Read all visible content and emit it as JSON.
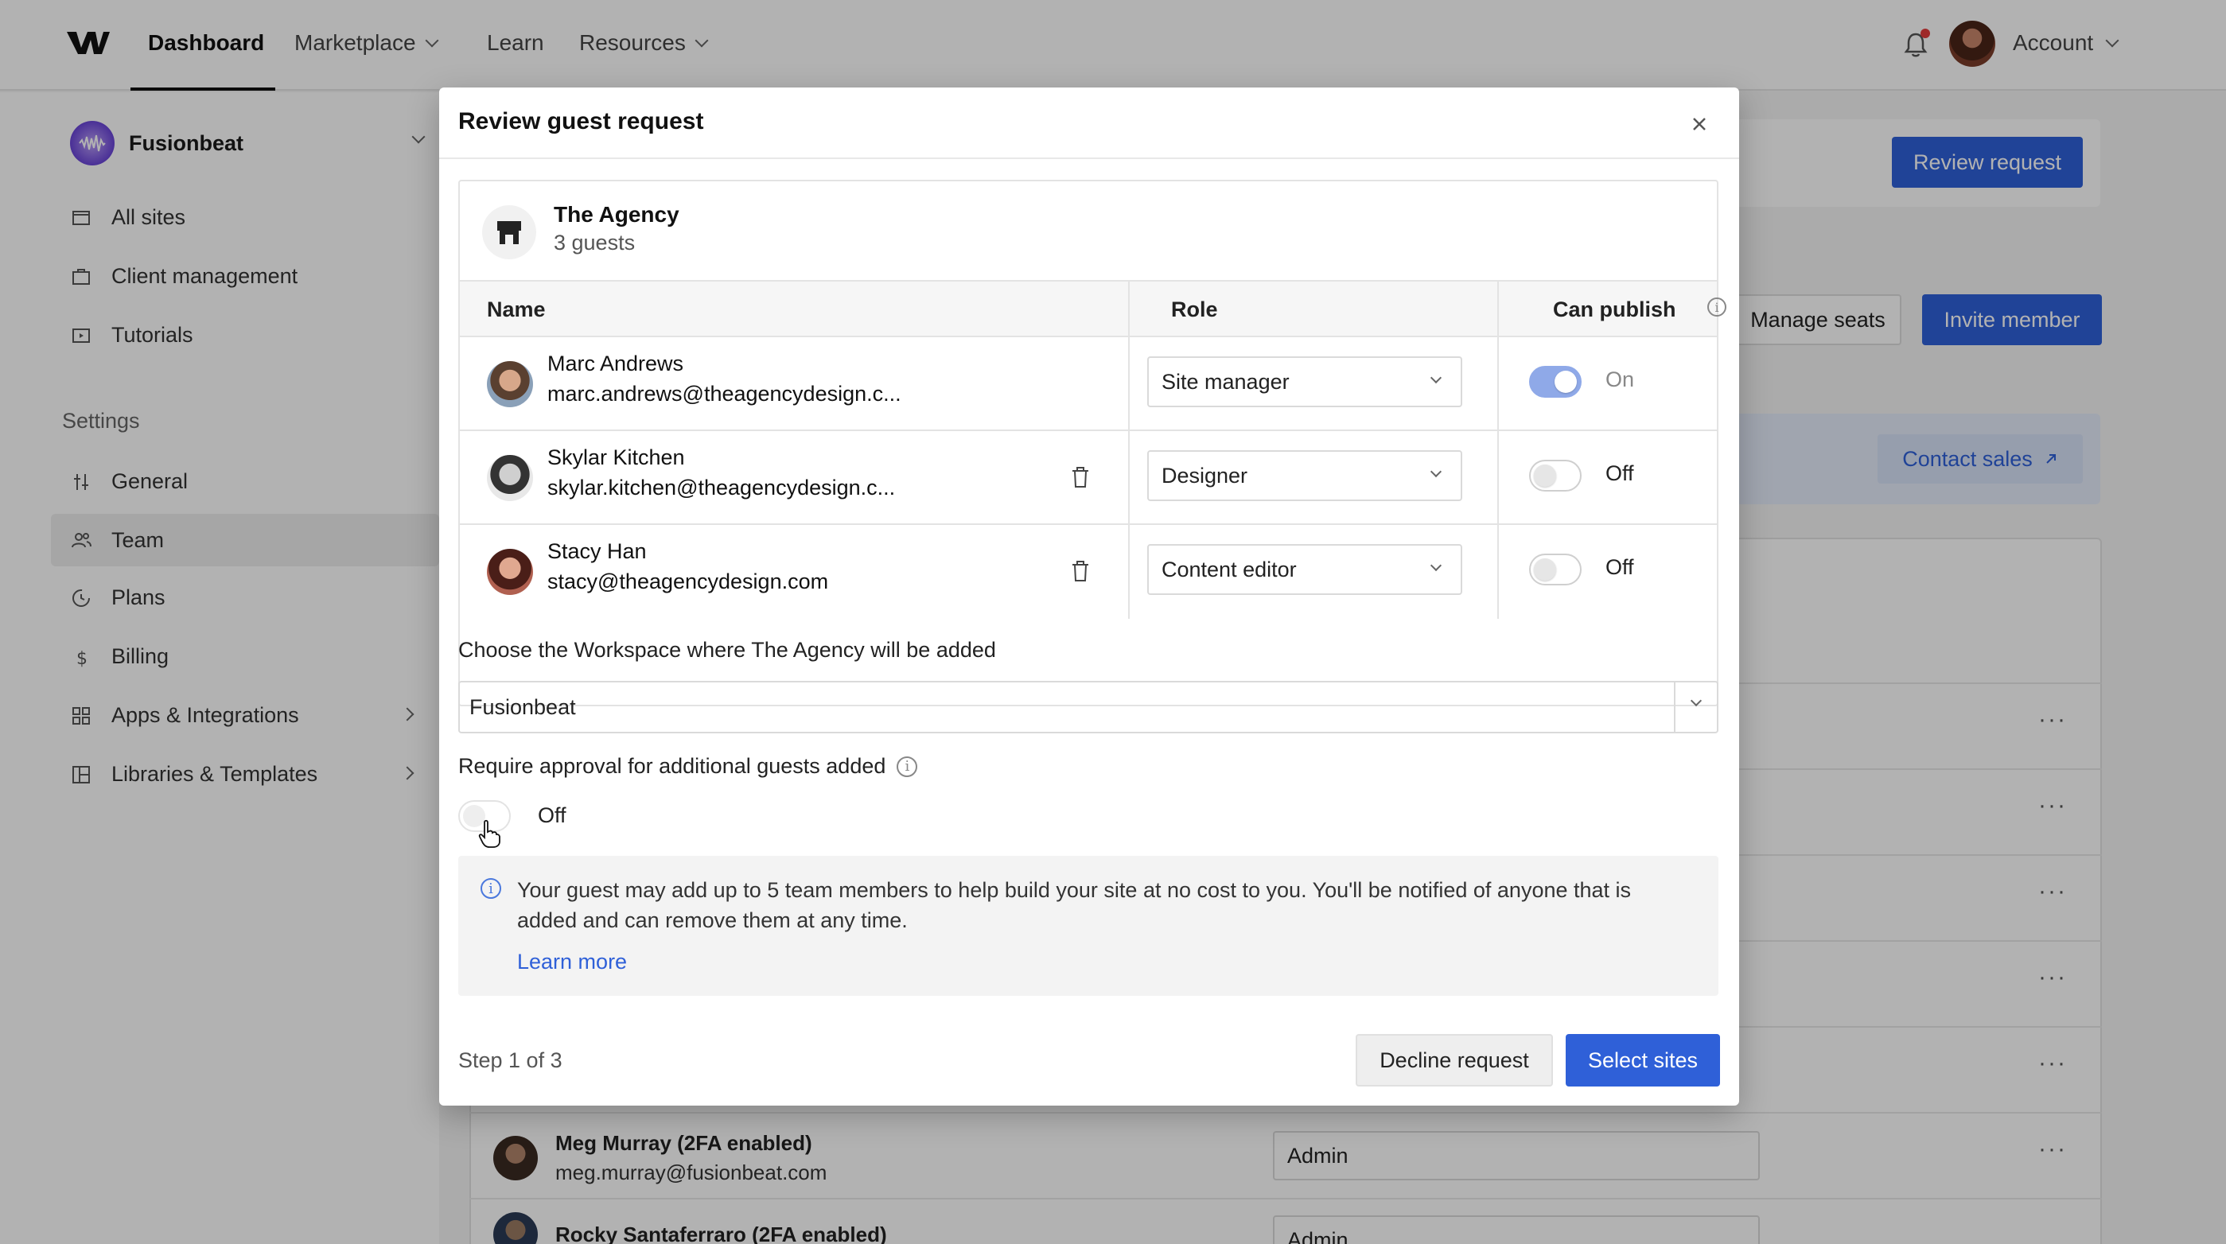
{
  "topnav": {
    "items": [
      {
        "label": "Dashboard"
      },
      {
        "label": "Marketplace"
      },
      {
        "label": "Learn"
      },
      {
        "label": "Resources"
      }
    ],
    "account_label": "Account"
  },
  "sidebar": {
    "workspace": "Fusionbeat",
    "items": [
      {
        "label": "All sites"
      },
      {
        "label": "Client management"
      },
      {
        "label": "Tutorials"
      }
    ],
    "settings_heading": "Settings",
    "settings_items": [
      {
        "label": "General"
      },
      {
        "label": "Team"
      },
      {
        "label": "Plans"
      },
      {
        "label": "Billing"
      },
      {
        "label": "Apps & Integrations"
      },
      {
        "label": "Libraries & Templates"
      }
    ]
  },
  "background": {
    "review_request": "Review request",
    "manage_seats": "Manage seats",
    "invite_member": "Invite member",
    "contact_sales": "Contact sales",
    "members": [
      {
        "name": "Meg Murray (2FA enabled)",
        "email": "meg.murray@fusionbeat.com",
        "role": "Admin"
      },
      {
        "name": "Rocky Santaferraro (2FA enabled)",
        "role": "Admin"
      }
    ]
  },
  "modal": {
    "title": "Review guest request",
    "agency_name": "The Agency",
    "agency_count": "3 guests",
    "columns": {
      "name": "Name",
      "role": "Role",
      "can_publish": "Can publish"
    },
    "guests": [
      {
        "name": "Marc Andrews",
        "email": "marc.andrews@theagencydesign.c...",
        "role": "Site manager",
        "publish": "On"
      },
      {
        "name": "Skylar Kitchen",
        "email": "skylar.kitchen@theagencydesign.c...",
        "role": "Designer",
        "publish": "Off"
      },
      {
        "name": "Stacy Han",
        "email": "stacy@theagencydesign.com",
        "role": "Content editor",
        "publish": "Off"
      }
    ],
    "workspace_label": "Choose the Workspace where The Agency will be added",
    "workspace_value": "Fusionbeat",
    "approval_label": "Require approval for additional guests added",
    "approval_state": "Off",
    "info_text": "Your guest may add up to 5 team members to help build your site at no cost to you. You'll be notified of anyone that is added and can remove them at any time.",
    "learn_more": "Learn more",
    "step": "Step 1 of 3",
    "decline": "Decline request",
    "select_sites": "Select sites"
  },
  "colors": {
    "accent": "#2f60d8",
    "toggle_on": "#8fa9e8"
  }
}
